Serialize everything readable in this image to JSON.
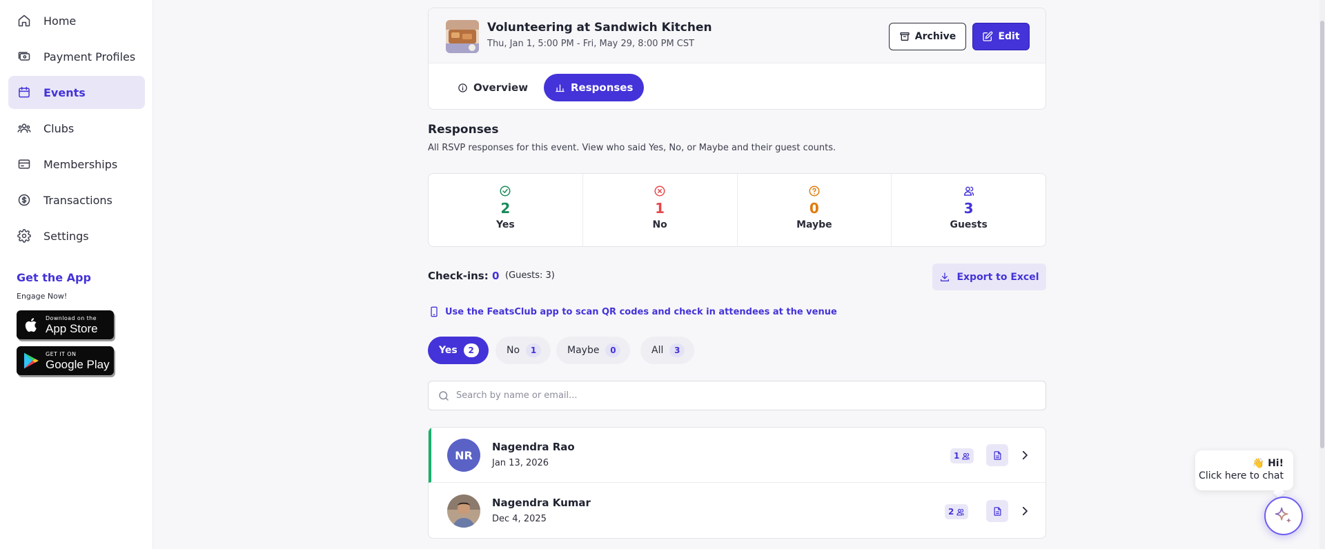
{
  "sidebar": {
    "items": [
      {
        "label": "Home",
        "icon": "home-icon"
      },
      {
        "label": "Payment Profiles",
        "icon": "payment-profiles-icon"
      },
      {
        "label": "Events",
        "icon": "calendar-icon",
        "active": true
      },
      {
        "label": "Clubs",
        "icon": "clubs-icon"
      },
      {
        "label": "Memberships",
        "icon": "memberships-icon"
      },
      {
        "label": "Transactions",
        "icon": "dollar-icon"
      },
      {
        "label": "Settings",
        "icon": "gear-icon"
      }
    ],
    "get_app_title": "Get the App",
    "get_app_subtitle": "Engage Now!",
    "app_store": {
      "small": "Download on the",
      "big": "App Store"
    },
    "google_play": {
      "small": "GET IT ON",
      "big": "Google Play"
    }
  },
  "event": {
    "title": "Volunteering at Sandwich Kitchen",
    "date_range": "Thu, Jan 1, 5:00 PM - Fri, May 29, 8:00 PM CST",
    "archive_label": "Archive",
    "edit_label": "Edit"
  },
  "tabs": [
    {
      "label": "Overview",
      "active": false
    },
    {
      "label": "Responses",
      "active": true
    }
  ],
  "responses": {
    "title": "Responses",
    "description": "All RSVP responses for this event. View who said Yes, No, or Maybe and their guest counts."
  },
  "stats": [
    {
      "count": "2",
      "label": "Yes",
      "color": "#1a8a5a",
      "icon": "check-circle-icon"
    },
    {
      "count": "1",
      "label": "No",
      "color": "#e5484d",
      "icon": "x-circle-icon"
    },
    {
      "count": "0",
      "label": "Maybe",
      "color": "#e07b0c",
      "icon": "question-circle-icon"
    },
    {
      "count": "3",
      "label": "Guests",
      "color": "#4433d8",
      "icon": "users-icon"
    }
  ],
  "checkins": {
    "label": "Check-ins:",
    "count": "0",
    "guests": "(Guests: 3)",
    "export_label": "Export to Excel",
    "scan_note": "Use the FeatsClub app to scan QR codes and check in attendees at the venue"
  },
  "filters": [
    {
      "label": "Yes",
      "count": "2",
      "active": true
    },
    {
      "label": "No",
      "count": "1",
      "active": false
    },
    {
      "label": "Maybe",
      "count": "0",
      "active": false
    },
    {
      "label": "All",
      "count": "3",
      "active": false
    }
  ],
  "search": {
    "placeholder": "Search by name or email..."
  },
  "attendees": [
    {
      "initials": "NR",
      "name": "Nagendra Rao",
      "date": "Jan 13, 2026",
      "guests": "1"
    },
    {
      "initials": "",
      "name": "Nagendra Kumar",
      "date": "Dec 4, 2025",
      "guests": "2"
    }
  ],
  "chat": {
    "greeting": "👋 Hi!",
    "prompt": "Click here to chat"
  },
  "colors": {
    "accent": "#4433d8",
    "accent_light": "#e9e7f7",
    "yes_bar": "#17b26a"
  }
}
